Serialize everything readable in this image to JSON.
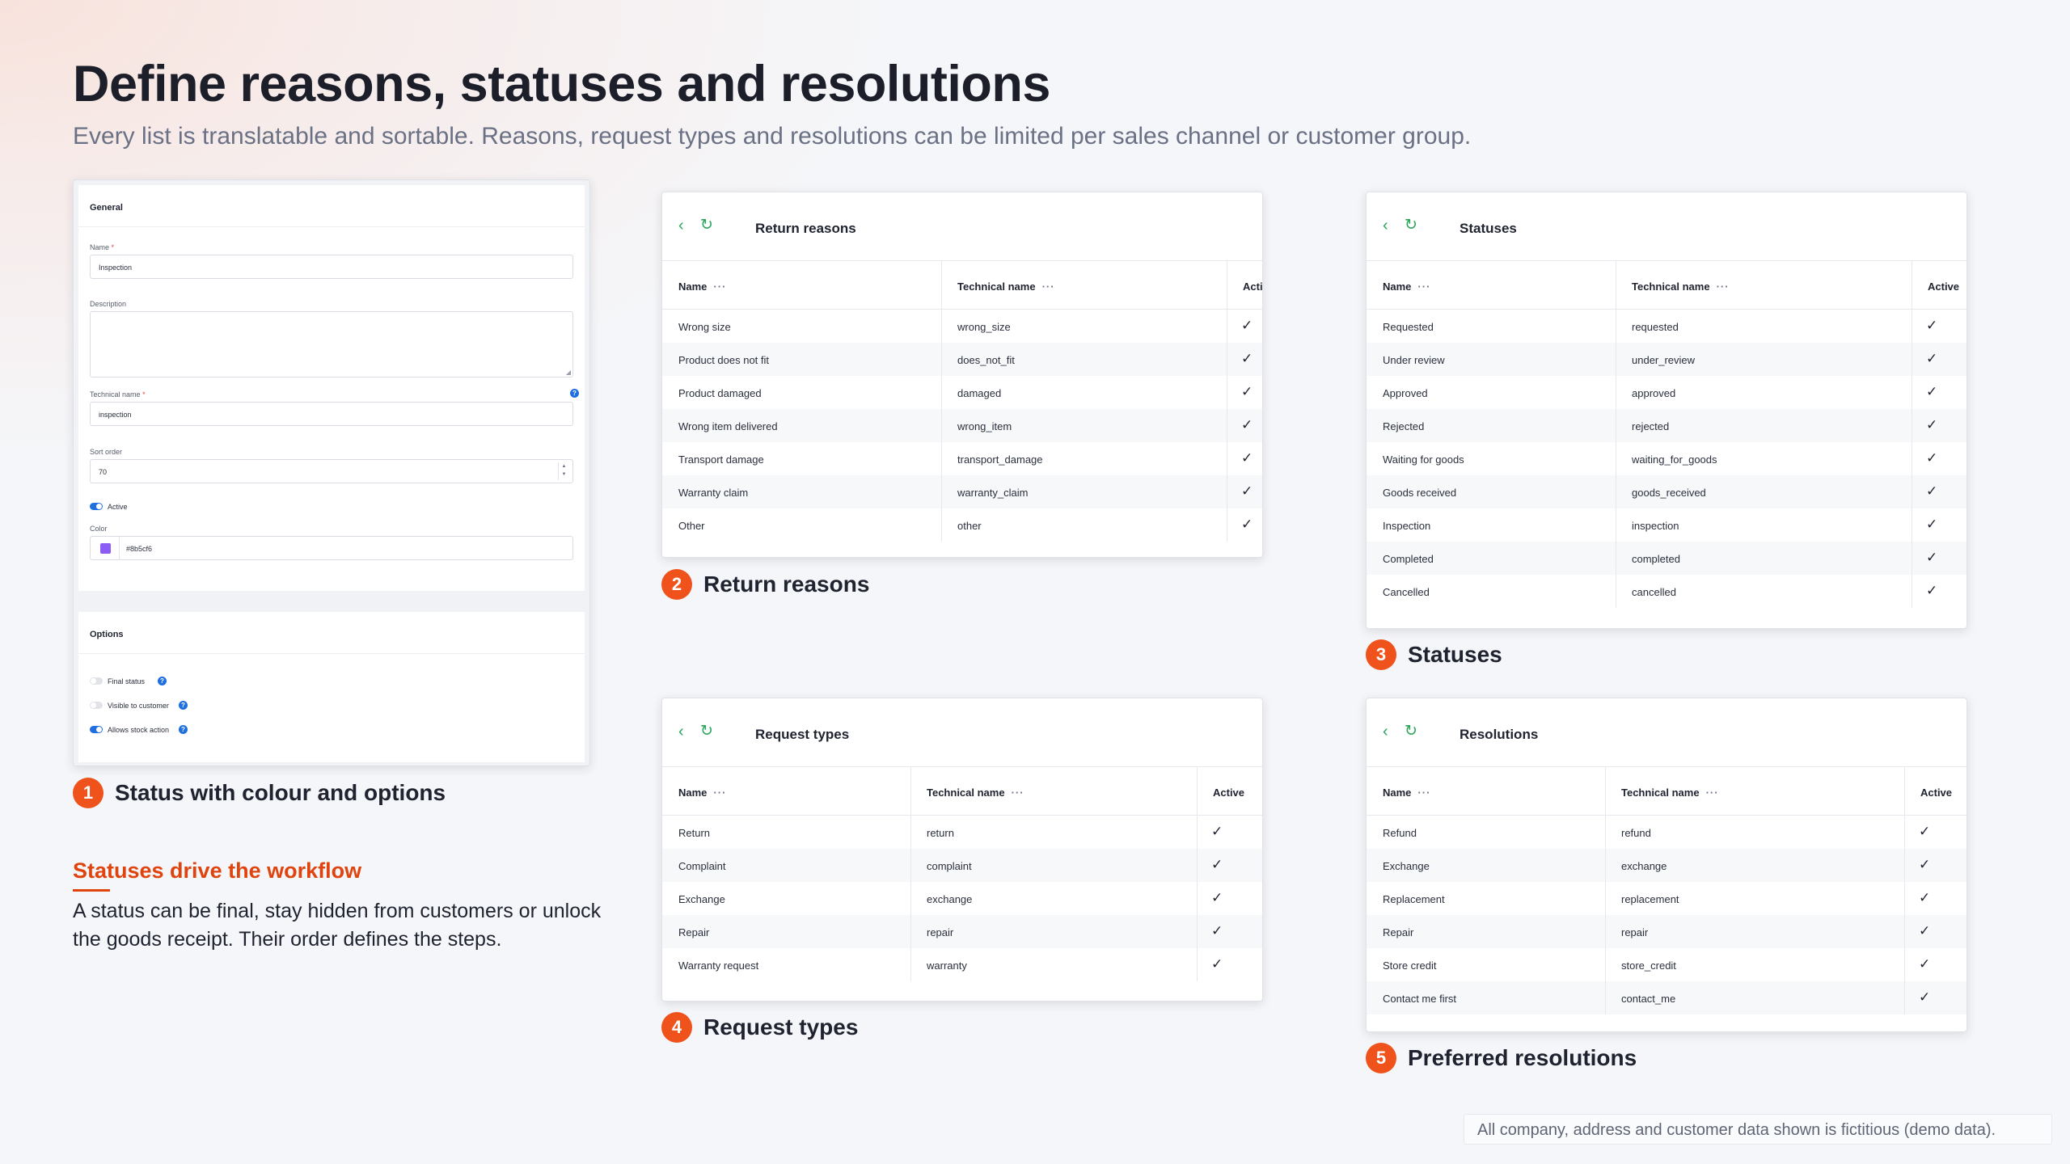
{
  "page": {
    "title": "Define reasons, statuses and resolutions",
    "subtitle": "Every list is translatable and sortable. Reasons, request types and resolutions can be limited per sales channel or customer group."
  },
  "form": {
    "general_heading": "General",
    "name_label": "Name",
    "name_value": "Inspection",
    "description_label": "Description",
    "technical_label": "Technical name",
    "technical_value": "inspection",
    "sort_label": "Sort order",
    "sort_value": "70",
    "active_label": "Active",
    "color_label": "Color",
    "color_value": "#8b5cf6",
    "options_heading": "Options",
    "final_status_label": "Final status",
    "visible_label": "Visible to customer",
    "stock_label": "Allows stock action"
  },
  "grids": {
    "reasons": {
      "title": "Return reasons",
      "col_name": "Name",
      "col_tech": "Technical name",
      "col_active": "Acti",
      "rows": [
        {
          "name": "Wrong size",
          "tech": "wrong_size"
        },
        {
          "name": "Product does not fit",
          "tech": "does_not_fit"
        },
        {
          "name": "Product damaged",
          "tech": "damaged"
        },
        {
          "name": "Wrong item delivered",
          "tech": "wrong_item"
        },
        {
          "name": "Transport damage",
          "tech": "transport_damage"
        },
        {
          "name": "Warranty claim",
          "tech": "warranty_claim"
        },
        {
          "name": "Other",
          "tech": "other"
        }
      ]
    },
    "statuses": {
      "title": "Statuses",
      "col_name": "Name",
      "col_tech": "Technical name",
      "col_active": "Active",
      "rows": [
        {
          "name": "Requested",
          "tech": "requested"
        },
        {
          "name": "Under review",
          "tech": "under_review"
        },
        {
          "name": "Approved",
          "tech": "approved"
        },
        {
          "name": "Rejected",
          "tech": "rejected"
        },
        {
          "name": "Waiting for goods",
          "tech": "waiting_for_goods"
        },
        {
          "name": "Goods received",
          "tech": "goods_received"
        },
        {
          "name": "Inspection",
          "tech": "inspection"
        },
        {
          "name": "Completed",
          "tech": "completed"
        },
        {
          "name": "Cancelled",
          "tech": "cancelled"
        }
      ]
    },
    "requests": {
      "title": "Request types",
      "col_name": "Name",
      "col_tech": "Technical name",
      "col_active": "Active",
      "rows": [
        {
          "name": "Return",
          "tech": "return"
        },
        {
          "name": "Complaint",
          "tech": "complaint"
        },
        {
          "name": "Exchange",
          "tech": "exchange"
        },
        {
          "name": "Repair",
          "tech": "repair"
        },
        {
          "name": "Warranty request",
          "tech": "warranty"
        }
      ]
    },
    "resolutions": {
      "title": "Resolutions",
      "col_name": "Name",
      "col_tech": "Technical name",
      "col_active": "Active",
      "rows": [
        {
          "name": "Refund",
          "tech": "refund"
        },
        {
          "name": "Exchange",
          "tech": "exchange"
        },
        {
          "name": "Replacement",
          "tech": "replacement"
        },
        {
          "name": "Repair",
          "tech": "repair"
        },
        {
          "name": "Store credit",
          "tech": "store_credit"
        },
        {
          "name": "Contact me first",
          "tech": "contact_me"
        }
      ]
    }
  },
  "captions": {
    "c1": {
      "num": "1",
      "text": "Status with colour and options"
    },
    "c2": {
      "num": "2",
      "text": "Return reasons"
    },
    "c3": {
      "num": "3",
      "text": "Statuses"
    },
    "c4": {
      "num": "4",
      "text": "Request types"
    },
    "c5": {
      "num": "5",
      "text": "Preferred resolutions"
    }
  },
  "workflow": {
    "heading": "Statuses drive the workflow",
    "body": "A status can be final, stay hidden from customers or unlock the goods receipt. Their order defines the steps."
  },
  "disclaimer": "All company, address and customer data shown is fictitious (demo data).",
  "icons": {
    "back": "chevron-left-icon",
    "refresh": "refresh-icon",
    "check": "checkmark-icon",
    "help": "help-icon"
  },
  "colors": {
    "accent": "#f0521b",
    "green": "#2aa55a",
    "blue": "#1f6fe0",
    "status_color": "#8b5cf6"
  }
}
